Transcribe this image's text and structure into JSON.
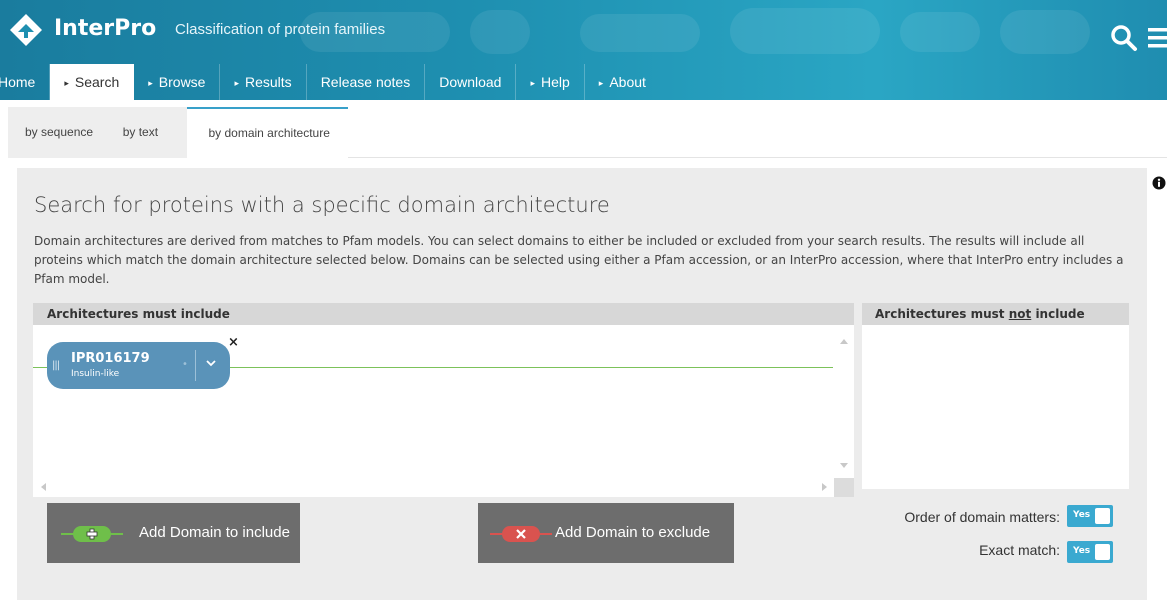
{
  "header": {
    "logo_text": "InterPro",
    "tagline": "Classification of protein families",
    "icons": [
      "interpro-logo-icon",
      "search-icon",
      "menu-icon"
    ]
  },
  "nav": {
    "items": [
      {
        "label": "Home",
        "arrow": false
      },
      {
        "label": "Search",
        "arrow": true,
        "active": true
      },
      {
        "label": "Browse",
        "arrow": true
      },
      {
        "label": "Results",
        "arrow": true
      },
      {
        "label": "Release notes",
        "arrow": false
      },
      {
        "label": "Download",
        "arrow": false
      },
      {
        "label": "Help",
        "arrow": true
      },
      {
        "label": "About",
        "arrow": true
      }
    ],
    "arrow_glyph": "▸"
  },
  "subtabs": {
    "items": [
      "by sequence",
      "by text",
      "by domain architecture"
    ],
    "active": "by domain architecture"
  },
  "panel": {
    "title": "Search for proteins with a specific domain architecture",
    "description": "Domain architectures are derived from matches to Pfam models. You can select domains to either be included or excluded from your search results. The results will include all proteins which match the domain architecture selected below. Domains can be selected using either a Pfam accession, or an InterPro accession, where that InterPro entry includes a Pfam model.",
    "include_header": "Architectures must include",
    "exclude_header_pre": "Architectures must ",
    "exclude_header_em": "not",
    "exclude_header_post": " include"
  },
  "domain": {
    "accession": "IPR016179",
    "name": "Insulin-like",
    "handle_glyph": "|||",
    "dot_glyph": "•",
    "close_glyph": "×"
  },
  "buttons": {
    "include_label": "Add Domain to include",
    "exclude_label": "Add Domain to exclude"
  },
  "options": {
    "order_label": "Order of domain matters:",
    "order_value": "Yes",
    "exact_label": "Exact match:",
    "exact_value": "Yes"
  },
  "colors": {
    "header_bg": "#1e8fb0",
    "domain_pill": "#5a93b9",
    "include_icon": "#6fbf4a",
    "exclude_icon": "#d9534f",
    "toggle": "#3aa9d0",
    "button_bg": "#6d6d6d"
  }
}
